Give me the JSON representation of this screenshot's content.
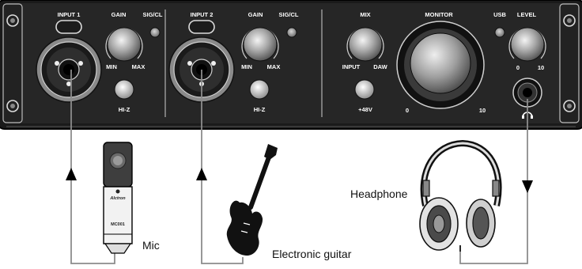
{
  "panel": {
    "channel1": {
      "input_label": "INPUT 1",
      "gain_label": "GAIN",
      "sig_label": "SIG/CL",
      "min_label": "MIN",
      "max_label": "MAX",
      "hiz_label": "HI-Z"
    },
    "channel2": {
      "input_label": "INPUT 2",
      "gain_label": "GAIN",
      "sig_label": "SIG/CL",
      "min_label": "MIN",
      "max_label": "MAX",
      "hiz_label": "HI-Z"
    },
    "mix": {
      "label": "MIX",
      "input_label": "INPUT",
      "daw_label": "DAW",
      "phantom_label": "+48V"
    },
    "monitor": {
      "label": "MONITOR",
      "min_label": "0",
      "max_label": "10"
    },
    "usb_label": "USB",
    "level": {
      "label": "LEVEL",
      "min_label": "0",
      "max_label": "10"
    }
  },
  "devices": {
    "mic": {
      "label": "Mic",
      "brand": "Alctron",
      "model": "MC001"
    },
    "guitar": {
      "label": "Electronic guitar"
    },
    "headphone": {
      "label": "Headphone"
    }
  },
  "colors": {
    "panel": "#262626",
    "panel_border": "#000000",
    "knob": "#9c9c9c",
    "cable": "#8c8c8c",
    "arrow": "#000000"
  }
}
